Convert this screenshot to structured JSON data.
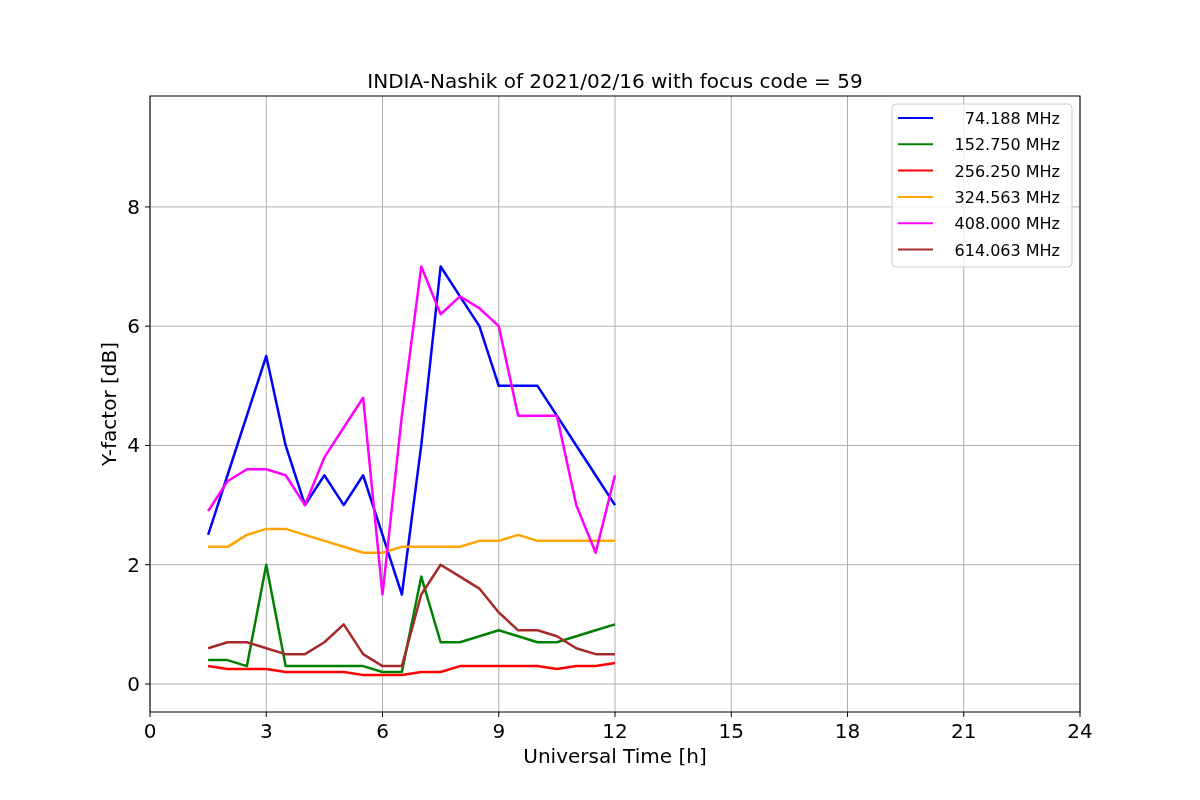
{
  "figure": {
    "chart_data": {
      "type": "line",
      "title": "INDIA-Nashik of 2021/02/16 with focus code = 59",
      "xlabel": "Universal Time [h]",
      "ylabel": "Y-factor [dB]",
      "x": [
        1.5,
        2,
        2.5,
        3,
        3.5,
        4,
        4.5,
        5,
        5.5,
        6,
        6.5,
        7,
        7.5,
        8,
        8.5,
        9,
        9.5,
        10,
        10.5,
        11,
        11.5,
        12
      ],
      "series": [
        {
          "name": " 74.188 MHz",
          "color": "#0000ff",
          "values": [
            2.5,
            3.5,
            4.5,
            5.5,
            4,
            3,
            3.5,
            3,
            3.5,
            2.5,
            1.5,
            4,
            7,
            6.5,
            6,
            5,
            5,
            5,
            4.5,
            4,
            3.5,
            3
          ]
        },
        {
          "name": "152.750 MHz",
          "color": "#008000",
          "values": [
            0.4,
            0.4,
            0.3,
            2,
            0.3,
            0.3,
            0.3,
            0.3,
            0.3,
            0.2,
            0.2,
            1.8,
            0.7,
            0.7,
            0.8,
            0.9,
            0.8,
            0.7,
            0.7,
            0.8,
            0.9,
            1.0
          ]
        },
        {
          "name": "256.250 MHz",
          "color": "#ff0000",
          "values": [
            0.3,
            0.25,
            0.25,
            0.25,
            0.2,
            0.2,
            0.2,
            0.2,
            0.15,
            0.15,
            0.15,
            0.2,
            0.2,
            0.3,
            0.3,
            0.3,
            0.3,
            0.3,
            0.25,
            0.3,
            0.3,
            0.35
          ]
        },
        {
          "name": "324.563 MHz",
          "color": "#ffa500",
          "values": [
            2.3,
            2.3,
            2.5,
            2.6,
            2.6,
            2.5,
            2.4,
            2.3,
            2.2,
            2.2,
            2.3,
            2.3,
            2.3,
            2.3,
            2.4,
            2.4,
            2.5,
            2.4,
            2.4,
            2.4,
            2.4,
            2.4
          ]
        },
        {
          "name": "408.000 MHz",
          "color": "#ff00ff",
          "values": [
            2.9,
            3.4,
            3.6,
            3.6,
            3.5,
            3.0,
            3.8,
            4.3,
            4.8,
            1.5,
            4.5,
            7.0,
            6.2,
            6.5,
            6.3,
            6.0,
            4.5,
            4.5,
            4.5,
            3.0,
            2.2,
            3.5
          ]
        },
        {
          "name": "614.063 MHz",
          "color": "#a52a2a",
          "values": [
            0.6,
            0.7,
            0.7,
            0.6,
            0.5,
            0.5,
            0.7,
            1.0,
            0.5,
            0.3,
            0.3,
            1.5,
            2.0,
            1.8,
            1.6,
            1.2,
            0.9,
            0.9,
            0.8,
            0.6,
            0.5,
            0.5
          ]
        }
      ],
      "xlim": [
        0,
        24
      ],
      "ylim": [
        -0.47,
        9.86
      ],
      "xticks": [
        0,
        3,
        6,
        9,
        12,
        15,
        18,
        21,
        24
      ],
      "yticks": [
        0,
        2,
        4,
        6,
        8
      ],
      "grid": true,
      "legend": true
    }
  }
}
